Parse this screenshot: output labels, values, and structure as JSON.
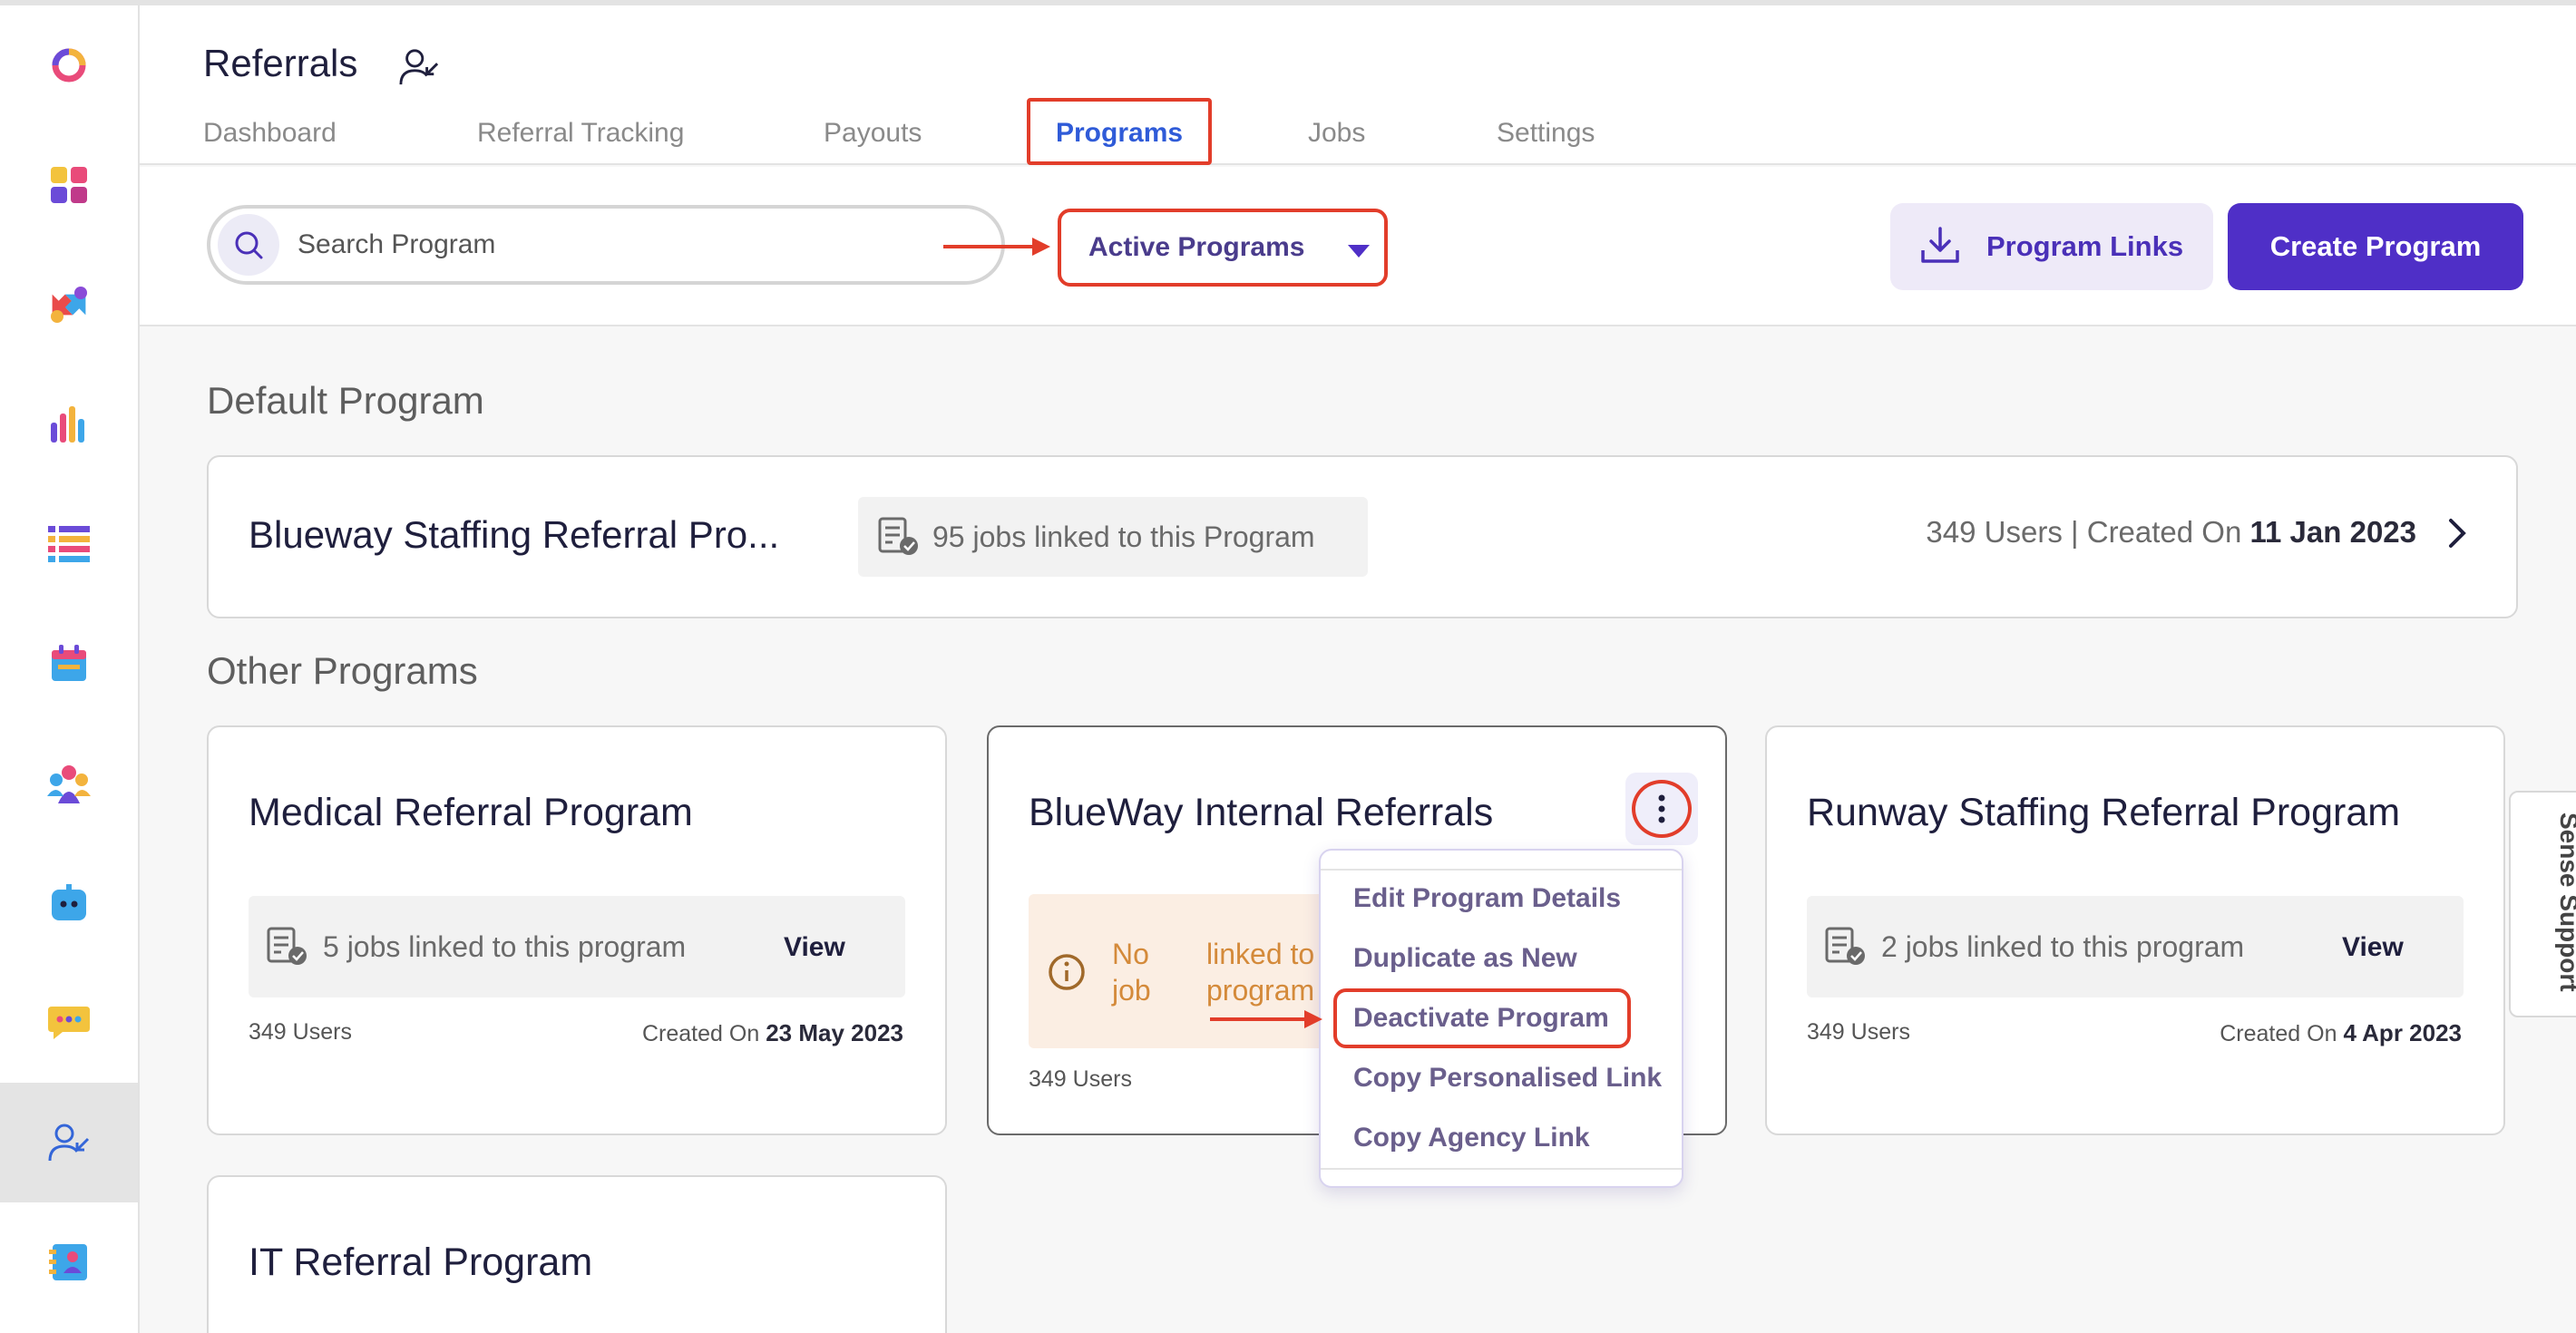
{
  "header": {
    "title": "Referrals",
    "tabs": [
      {
        "label": "Dashboard"
      },
      {
        "label": "Referral Tracking"
      },
      {
        "label": "Payouts"
      },
      {
        "label": "Programs"
      },
      {
        "label": "Jobs"
      },
      {
        "label": "Settings"
      }
    ],
    "active_tab": "Programs"
  },
  "toolbar": {
    "search_placeholder": "Search Program",
    "filter_selected": "Active Programs",
    "program_links_label": "Program Links",
    "create_program_label": "Create Program"
  },
  "default_section": {
    "title": "Default Program",
    "card": {
      "name": "Blueway Staffing Referral Pro...",
      "jobs_text": "95 jobs linked to this Program",
      "users_text": "349 Users | Created On",
      "created_date": "11 Jan 2023"
    }
  },
  "other_section": {
    "title": "Other Programs",
    "cards": [
      {
        "name": "Medical Referral Program",
        "jobs_text": "5 jobs linked to this program",
        "view_label": "View",
        "users": "349 Users",
        "created_label": "Created On",
        "created_date": "23 May 2023"
      },
      {
        "name": "BlueWay Internal Referrals",
        "warn_word1": "No job",
        "warn_word2": "linked to program",
        "users": "349 Users"
      },
      {
        "name": "Runway Staffing Referral Program",
        "jobs_text": "2 jobs linked to this program",
        "view_label": "View",
        "users": "349 Users",
        "created_label": "Created On",
        "created_date": "4 Apr 2023"
      },
      {
        "name": "IT Referral Program"
      }
    ]
  },
  "context_menu": {
    "items": [
      "Edit Program Details",
      "Duplicate as New",
      "Deactivate Program",
      "Copy Personalised Link",
      "Copy Agency Link"
    ]
  },
  "support_tab": {
    "label": "Sense Support"
  },
  "colors": {
    "accent": "#4f2fc7",
    "highlight": "#e23d2a",
    "tab_active": "#2f5bd8",
    "warning_text": "#d48a3a"
  },
  "icons": {
    "sidebar": [
      "app-logo-icon",
      "apps-grid-icon",
      "arrows-exchange-icon",
      "bar-chart-icon",
      "list-icon",
      "calendar-icon",
      "team-icon",
      "bot-icon",
      "chat-icon",
      "referral-icon",
      "contacts-icon"
    ]
  }
}
